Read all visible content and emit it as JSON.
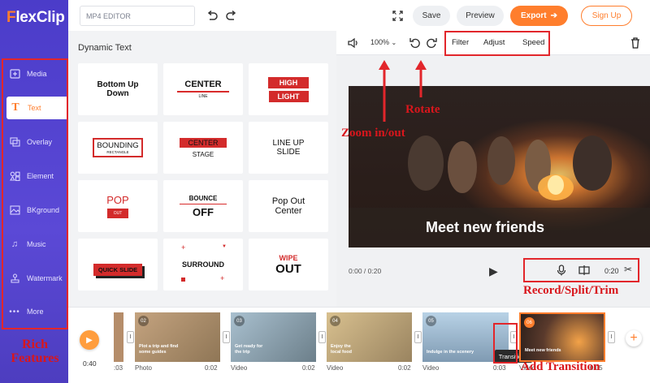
{
  "app": {
    "name": "FlexClip"
  },
  "topbar": {
    "project_name": "MP4 EDITOR",
    "save": "Save",
    "preview": "Preview",
    "export": "Export",
    "signup": "Sign Up"
  },
  "sidebar": {
    "items": [
      {
        "label": "Media",
        "icon": "media-icon"
      },
      {
        "label": "Text",
        "icon": "text-icon"
      },
      {
        "label": "Overlay",
        "icon": "overlay-icon"
      },
      {
        "label": "Element",
        "icon": "element-icon"
      },
      {
        "label": "BKground",
        "icon": "background-icon"
      },
      {
        "label": "Music",
        "icon": "music-icon"
      },
      {
        "label": "Watermark",
        "icon": "watermark-icon"
      },
      {
        "label": "More",
        "icon": "more-icon"
      }
    ],
    "active": "Text"
  },
  "panel": {
    "title": "Dynamic Text",
    "cards": [
      {
        "lines": [
          "Bottom Up",
          "Down"
        ]
      },
      {
        "lines": [
          "CENTER",
          "LINE"
        ]
      },
      {
        "lines": [
          "HIGH",
          "LIGHT"
        ]
      },
      {
        "lines": [
          "BOUNDING",
          "RECTANGLE"
        ]
      },
      {
        "lines": [
          "CENTER",
          "STAGE"
        ]
      },
      {
        "lines": [
          "LINE UP",
          "SLIDE"
        ]
      },
      {
        "lines": [
          "POP",
          "OUT"
        ]
      },
      {
        "lines": [
          "BOUNCE",
          "OFF"
        ]
      },
      {
        "lines": [
          "Pop Out",
          "Center"
        ]
      },
      {
        "lines": [
          "QUICK SLIDE"
        ]
      },
      {
        "lines": [
          "SURROUND"
        ]
      },
      {
        "lines": [
          "WIPE",
          "OUT"
        ]
      }
    ]
  },
  "preview": {
    "zoom": "100%",
    "tabs": [
      "Filter",
      "Adjust",
      "Speed"
    ],
    "overlay_text": "Meet new friends",
    "time_current": "0:00 / 0:20",
    "clip_duration": "0:20"
  },
  "timeline": {
    "total_time": "0:40",
    "clips": [
      {
        "num": "02",
        "caption": "Plot a trip and find\nsome guides",
        "type": "Photo",
        "duration": "0:02",
        "color": "#b89b77"
      },
      {
        "num": "03",
        "caption": "Get ready for\nthe trip",
        "type": "Video",
        "duration": "0:02",
        "color": "#8aa5b8"
      },
      {
        "num": "04",
        "caption": "Enjoy the\nlocal food",
        "type": "Video",
        "duration": "0:02",
        "color": "#c9b089"
      },
      {
        "num": "05",
        "caption": "Indulge in the scenery",
        "type": "Video",
        "duration": "0:03",
        "color": "#97b7d2"
      },
      {
        "num": "06",
        "caption": "Meet new friends",
        "type": "Video",
        "duration": "0:05",
        "color": "#4a3a33"
      }
    ],
    "first_partial_duration": ":03",
    "transition_label": "Transitions"
  },
  "annotations": {
    "rich_features": "Rich Features",
    "zoom": "Zoom in/out",
    "rotate": "Rotate",
    "record_split_trim": "Record/Split/Trim",
    "add_transition": "Add Transition"
  },
  "colors": {
    "accent": "#ff7e2d",
    "sidebar": "#4b3cc9",
    "annotation": "#e2262b"
  }
}
